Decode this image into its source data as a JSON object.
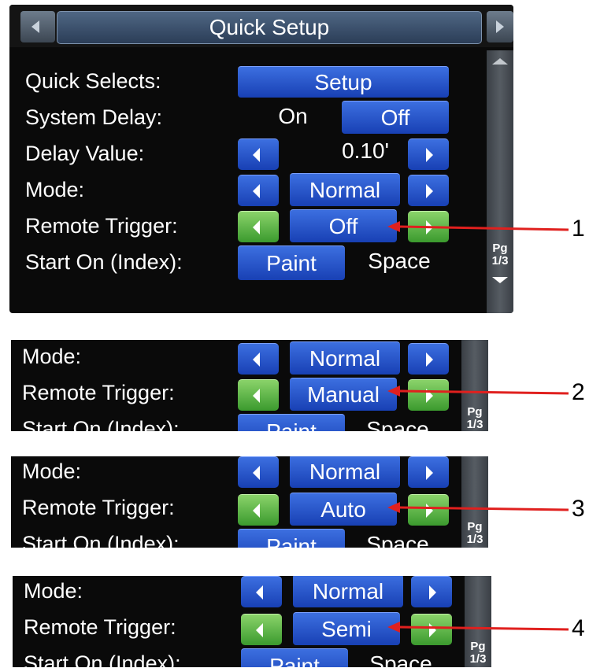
{
  "main": {
    "title": "Quick Setup",
    "rows": {
      "quick_selects": {
        "label": "Quick Selects:",
        "button": "Setup"
      },
      "system_delay": {
        "label": "System Delay:",
        "on": "On",
        "off": "Off"
      },
      "delay_value": {
        "label": "Delay Value:",
        "value": "0.10'"
      },
      "mode": {
        "label": "Mode:",
        "value": "Normal"
      },
      "remote_trigger": {
        "label": "Remote Trigger:",
        "value": "Off"
      },
      "start_on": {
        "label": "Start On (Index):",
        "paint": "Paint",
        "space": "Space"
      }
    },
    "page_indicator": {
      "pg": "Pg",
      "num": "1/3"
    }
  },
  "variants": [
    {
      "mode_label": "Mode:",
      "mode_value": "Normal",
      "trigger_label": "Remote Trigger:",
      "trigger_value": "Manual",
      "start_label": "Start On (Index):",
      "paint": "Paint",
      "space": "Space",
      "pg": "Pg",
      "pg_num": "1/3"
    },
    {
      "mode_label": "Mode:",
      "mode_value": "Normal",
      "trigger_label": "Remote Trigger:",
      "trigger_value": "Auto",
      "start_label": "Start On (Index):",
      "paint": "Paint",
      "space": "Space",
      "pg": "Pg",
      "pg_num": "1/3"
    },
    {
      "mode_label": "Mode:",
      "mode_value": "Normal",
      "trigger_label": "Remote Trigger:",
      "trigger_value": "Semi",
      "start_label": "Start On (Index):",
      "paint": "Paint",
      "space": "Space",
      "pg": "Pg",
      "pg_num": "1/3"
    }
  ],
  "callouts": [
    "1",
    "2",
    "3",
    "4"
  ],
  "colors": {
    "button_blue": "#2456d0",
    "button_green": "#55b43f",
    "arrow_red": "#e0201e",
    "panel_bg": "#0a0a0a"
  }
}
